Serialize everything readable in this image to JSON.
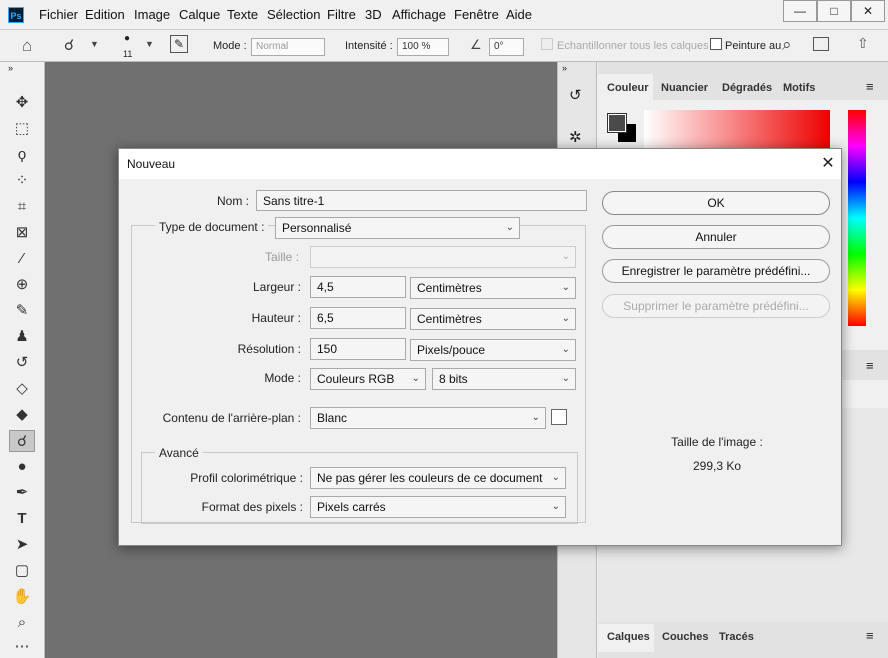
{
  "menubar": {
    "logo": "Ps",
    "items": [
      "Fichier",
      "Edition",
      "Image",
      "Calque",
      "Texte",
      "Sélection",
      "Filtre",
      "3D",
      "Affichage",
      "Fenêtre",
      "Aide"
    ],
    "minimize": "—",
    "maximize": "□",
    "close": "✕"
  },
  "options": {
    "brush_size": "11",
    "mode_label": "Mode :",
    "mode_value": "Normal",
    "intensity_label": "Intensité :",
    "intensity_value": "100 %",
    "angle_value": "0°",
    "sample_all_label": "Echantillonner tous les calques",
    "finger_paint_label": "Peinture au"
  },
  "panels": {
    "color_tabs": [
      "Couleur",
      "Nuancier",
      "Dégradés",
      "Motifs"
    ],
    "layer_tabs": [
      "Calques",
      "Couches",
      "Tracés"
    ]
  },
  "dialog": {
    "title": "Nouveau",
    "name_label": "Nom :",
    "name_value": "Sans titre-1",
    "doc_type_label": "Type de document :",
    "doc_type_value": "Personnalisé",
    "size_label": "Taille :",
    "size_value": "",
    "width_label": "Largeur :",
    "width_value": "4,5",
    "width_unit": "Centimètres",
    "height_label": "Hauteur :",
    "height_value": "6,5",
    "height_unit": "Centimètres",
    "resolution_label": "Résolution :",
    "resolution_value": "150",
    "resolution_unit": "Pixels/pouce",
    "mode_label": "Mode :",
    "mode_value": "Couleurs RGB",
    "bits_value": "8 bits",
    "background_label": "Contenu de l'arrière-plan :",
    "background_value": "Blanc",
    "advanced_label": "Avancé",
    "profile_label": "Profil colorimétrique :",
    "profile_value": "Ne pas gérer les couleurs de ce document",
    "pixel_format_label": "Format des pixels :",
    "pixel_format_value": "Pixels carrés",
    "ok_button": "OK",
    "cancel_button": "Annuler",
    "save_preset_button": "Enregistrer le paramètre prédéfini...",
    "delete_preset_button": "Supprimer le paramètre prédéfini...",
    "image_size_label": "Taille de l'image :",
    "image_size_value": "299,3 Ko"
  },
  "colors": {
    "canvas": "#707070",
    "fg_swatch": "#4a4a4a",
    "bg_swatch": "#000000"
  }
}
